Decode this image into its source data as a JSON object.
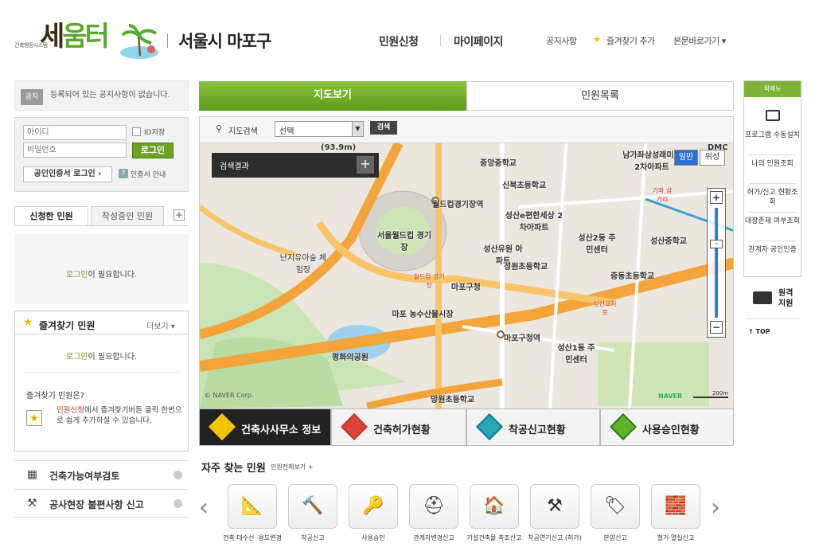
{
  "header": {
    "logo_sub": "건축행정시스템",
    "logo_main_a": "세",
    "logo_main_b": "움터",
    "district": "서울시 마포구",
    "nav": [
      "민원신청",
      "마이페이지"
    ],
    "util": [
      "공지사항",
      "즐겨찾기 추가",
      "본문바로가기"
    ]
  },
  "notice": {
    "badge": "공지",
    "text": "등록되어 있는 공지사항이 없습니다."
  },
  "login": {
    "id_placeholder": "아이디",
    "pw_placeholder": "비밀번호",
    "save_id": "ID저장",
    "login_btn": "로그인",
    "cert_btn": "공인인증서 로그인 ›",
    "cert_help": "인증서 안내"
  },
  "left_tabs": [
    "신청한 민원",
    "작성중인 민원"
  ],
  "login_required_a": "로그인",
  "login_required_b": "이 필요합니다.",
  "favorites": {
    "title": "즐겨찾기 민원",
    "more": "더보기 ▾",
    "question": "즐겨찾기 민원은?",
    "desc_a": "민원신청",
    "desc_b": "에서 즐겨찾기버튼 클릭 한번으로 쉽게 추가하실 수 있습니다."
  },
  "bottom_links": [
    "건축가능여부검토",
    "공사현장 불편사항 신고"
  ],
  "map_tabs": [
    "지도보기",
    "민원목록"
  ],
  "search": {
    "label": "지도검색",
    "select": "선택",
    "button": "검색"
  },
  "map": {
    "result_title": "검색결과",
    "type_normal": "일반",
    "type_satellite": "위성",
    "copyright": "© NAVER Corp.",
    "naver": "NAVER",
    "scale": "200m",
    "labels": [
      "(93.9m)",
      "중앙중학교",
      "신북초등학교",
      "월드컵경기장역",
      "성산e편한세상 2차아파트",
      "남가좌삼성래미안 2차아파트",
      "서울월드컵 경기장",
      "성산2동 주민센터",
      "성산중학교",
      "난지유아숲 체험장",
      "성산유원 아파트",
      "성원초등학교",
      "중동초등학교",
      "마포구청",
      "월드컵 경기장",
      "마포 농수산물시장",
      "마포구청역",
      "성산1동 주민센터",
      "평화의공원",
      "성산교차로",
      "망원초등학교",
      "가좌 삼거리",
      "DMC"
    ]
  },
  "info_tabs": [
    "건축사사무소 정보",
    "건축허가현황",
    "착공신고현황",
    "사용승인현황"
  ],
  "frequent": {
    "title": "자주 찾는 민원",
    "all": "민원전체보기 +",
    "items": [
      "건축·대수선 ·용도변경",
      "착공신고",
      "사용승인",
      "관계자변경신고",
      "가설건축물 축조신고",
      "착공연기신고 (허가)",
      "분양신고",
      "철거·멸실신고"
    ]
  },
  "quick": {
    "head": "퀵메뉴",
    "items": [
      "프로그램 수동설치",
      "나의 민원조회",
      "허가/신고 현황조회",
      "대장존재 여부조회",
      "관계자 공인인증"
    ],
    "remote": "원격 지원",
    "top": "TOP"
  }
}
